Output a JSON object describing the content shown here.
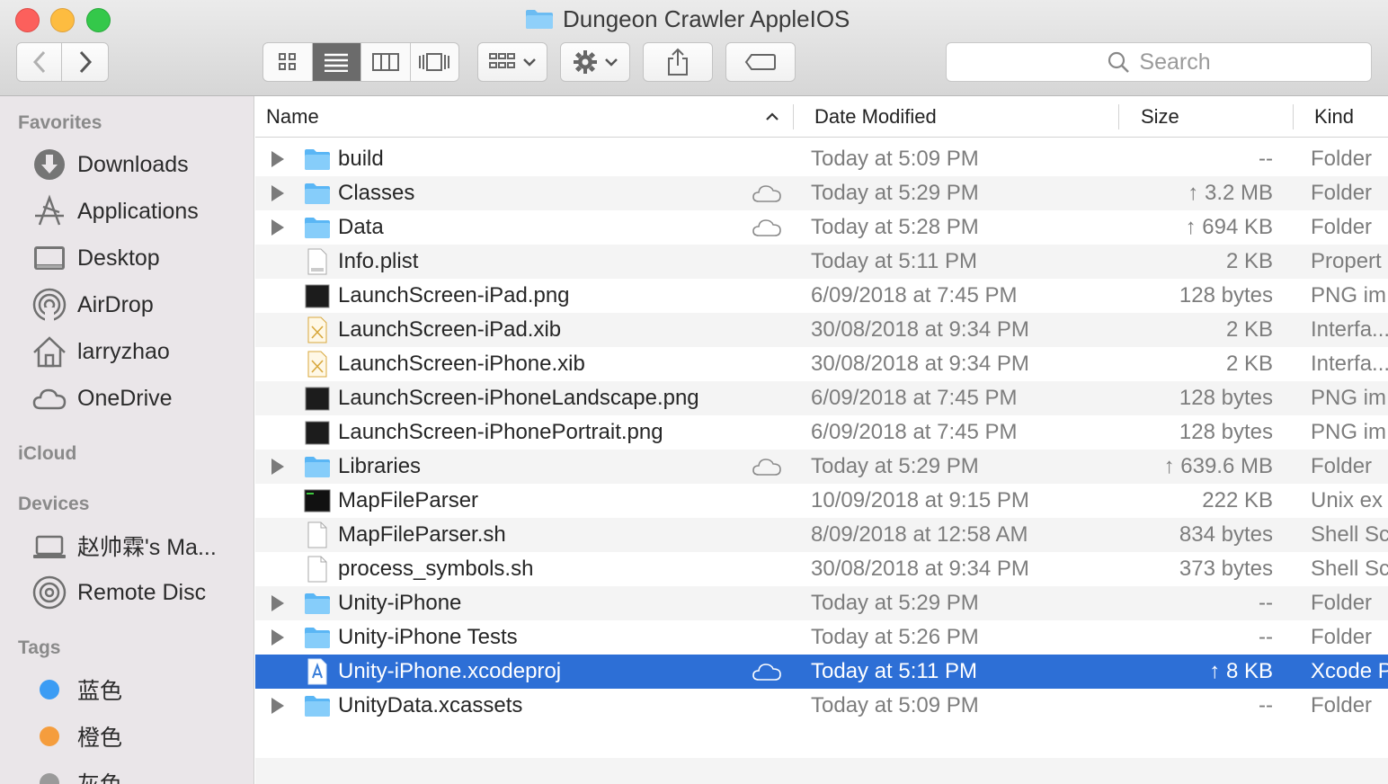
{
  "window": {
    "title": "Dungeon Crawler AppleIOS"
  },
  "toolbar": {
    "back_icon": "chevron-left-icon",
    "forward_icon": "chevron-right-icon",
    "view_modes": [
      "icon-view",
      "list-view",
      "column-view",
      "cover-flow-view"
    ],
    "active_view": "list-view",
    "search_placeholder": "Search"
  },
  "sidebar": {
    "favorites_header": "Favorites",
    "favorites": [
      {
        "label": "Downloads",
        "icon": "download-icon"
      },
      {
        "label": "Applications",
        "icon": "applications-icon"
      },
      {
        "label": "Desktop",
        "icon": "desktop-icon"
      },
      {
        "label": "AirDrop",
        "icon": "airdrop-icon"
      },
      {
        "label": "larryzhao",
        "icon": "home-icon"
      },
      {
        "label": "OneDrive",
        "icon": "cloud-icon"
      }
    ],
    "icloud_header": "iCloud",
    "devices_header": "Devices",
    "devices": [
      {
        "label": "赵帅霖's Ma...",
        "icon": "laptop-icon"
      },
      {
        "label": "Remote Disc",
        "icon": "disc-icon"
      }
    ],
    "tags_header": "Tags",
    "tags": [
      {
        "label": "蓝色",
        "color": "#3b9cf4"
      },
      {
        "label": "橙色",
        "color": "#f59d3d"
      },
      {
        "label": "灰色",
        "color": "#9a9a9a"
      }
    ]
  },
  "columns": {
    "name": "Name",
    "date": "Date Modified",
    "size": "Size",
    "kind": "Kind",
    "sort_indicator": "chevron-up-icon"
  },
  "files": [
    {
      "name": "build",
      "type": "folder",
      "expandable": true,
      "cloud": false,
      "date": "Today at 5:09 PM",
      "size": "--",
      "kind": "Folder"
    },
    {
      "name": "Classes",
      "type": "folder",
      "expandable": true,
      "cloud": true,
      "date": "Today at 5:29 PM",
      "size": "↑ 3.2 MB",
      "kind": "Folder"
    },
    {
      "name": "Data",
      "type": "folder",
      "expandable": true,
      "cloud": true,
      "date": "Today at 5:28 PM",
      "size": "↑ 694 KB",
      "kind": "Folder"
    },
    {
      "name": "Info.plist",
      "type": "plist",
      "expandable": false,
      "cloud": false,
      "date": "Today at 5:11 PM",
      "size": "2 KB",
      "kind": "Propert"
    },
    {
      "name": "LaunchScreen-iPad.png",
      "type": "png",
      "expandable": false,
      "cloud": false,
      "date": "6/09/2018 at 7:45 PM",
      "size": "128 bytes",
      "kind": "PNG im"
    },
    {
      "name": "LaunchScreen-iPad.xib",
      "type": "xib",
      "expandable": false,
      "cloud": false,
      "date": "30/08/2018 at 9:34 PM",
      "size": "2 KB",
      "kind": "Interfa..."
    },
    {
      "name": "LaunchScreen-iPhone.xib",
      "type": "xib",
      "expandable": false,
      "cloud": false,
      "date": "30/08/2018 at 9:34 PM",
      "size": "2 KB",
      "kind": "Interfa..."
    },
    {
      "name": "LaunchScreen-iPhoneLandscape.png",
      "type": "png",
      "expandable": false,
      "cloud": false,
      "date": "6/09/2018 at 7:45 PM",
      "size": "128 bytes",
      "kind": "PNG im"
    },
    {
      "name": "LaunchScreen-iPhonePortrait.png",
      "type": "png",
      "expandable": false,
      "cloud": false,
      "date": "6/09/2018 at 7:45 PM",
      "size": "128 bytes",
      "kind": "PNG im"
    },
    {
      "name": "Libraries",
      "type": "folder",
      "expandable": true,
      "cloud": true,
      "date": "Today at 5:29 PM",
      "size": "↑ 639.6 MB",
      "kind": "Folder"
    },
    {
      "name": "MapFileParser",
      "type": "exec",
      "expandable": false,
      "cloud": false,
      "date": "10/09/2018 at 9:15 PM",
      "size": "222 KB",
      "kind": "Unix ex"
    },
    {
      "name": "MapFileParser.sh",
      "type": "doc",
      "expandable": false,
      "cloud": false,
      "date": "8/09/2018 at 12:58 AM",
      "size": "834 bytes",
      "kind": "Shell Sc"
    },
    {
      "name": "process_symbols.sh",
      "type": "doc",
      "expandable": false,
      "cloud": false,
      "date": "30/08/2018 at 9:34 PM",
      "size": "373 bytes",
      "kind": "Shell Sc"
    },
    {
      "name": "Unity-iPhone",
      "type": "folder",
      "expandable": true,
      "cloud": false,
      "date": "Today at 5:29 PM",
      "size": "--",
      "kind": "Folder"
    },
    {
      "name": "Unity-iPhone Tests",
      "type": "folder",
      "expandable": true,
      "cloud": false,
      "date": "Today at 5:26 PM",
      "size": "--",
      "kind": "Folder"
    },
    {
      "name": "Unity-iPhone.xcodeproj",
      "type": "xcodeproj",
      "expandable": false,
      "cloud": true,
      "selected": true,
      "date": "Today at 5:11 PM",
      "size": "↑ 8 KB",
      "kind": "Xcode P"
    },
    {
      "name": "UnityData.xcassets",
      "type": "folder",
      "expandable": true,
      "cloud": false,
      "date": "Today at 5:09 PM",
      "size": "--",
      "kind": "Folder"
    }
  ],
  "colors": {
    "selection": "#2d6fd6",
    "folder": "#5ab6f5",
    "sidebar_bg": "#eae6e9"
  }
}
